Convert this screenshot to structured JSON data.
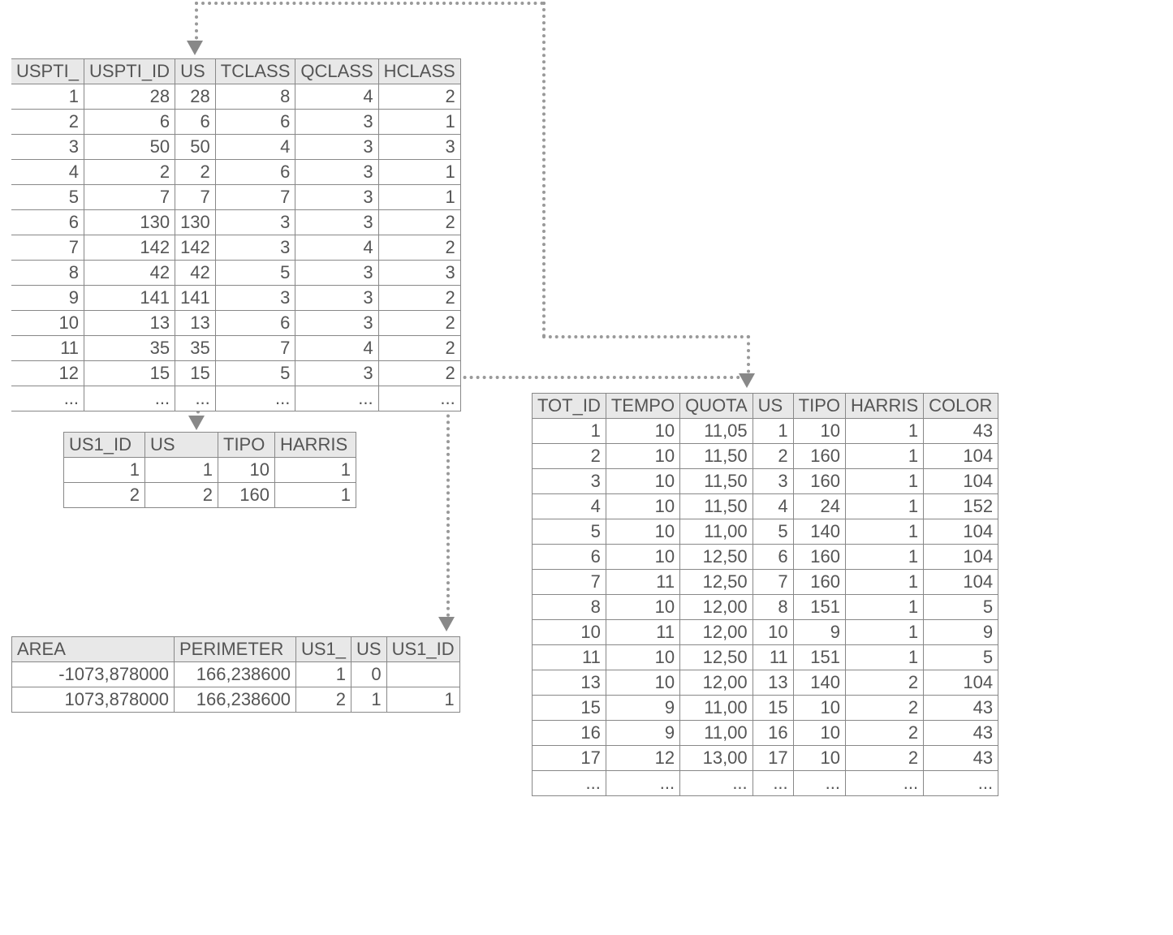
{
  "table_top": {
    "headers": [
      "USPTI_",
      "USPTI_ID",
      "US",
      "TCLASS",
      "QCLASS",
      "HCLASS"
    ],
    "rows": [
      [
        "1",
        "28",
        "28",
        "8",
        "4",
        "2"
      ],
      [
        "2",
        "6",
        "6",
        "6",
        "3",
        "1"
      ],
      [
        "3",
        "50",
        "50",
        "4",
        "3",
        "3"
      ],
      [
        "4",
        "2",
        "2",
        "6",
        "3",
        "1"
      ],
      [
        "5",
        "7",
        "7",
        "7",
        "3",
        "1"
      ],
      [
        "6",
        "130",
        "130",
        "3",
        "3",
        "2"
      ],
      [
        "7",
        "142",
        "142",
        "3",
        "4",
        "2"
      ],
      [
        "8",
        "42",
        "42",
        "5",
        "3",
        "3"
      ],
      [
        "9",
        "141",
        "141",
        "3",
        "3",
        "2"
      ],
      [
        "10",
        "13",
        "13",
        "6",
        "3",
        "2"
      ],
      [
        "11",
        "35",
        "35",
        "7",
        "4",
        "2"
      ],
      [
        "12",
        "15",
        "15",
        "5",
        "3",
        "2"
      ],
      [
        "...",
        "...",
        "...",
        "...",
        "...",
        "..."
      ]
    ]
  },
  "table_mid": {
    "headers": [
      "US1_ID",
      "US",
      "TIPO",
      "HARRIS"
    ],
    "rows": [
      [
        "1",
        "1",
        "10",
        "1"
      ],
      [
        "2",
        "2",
        "160",
        "1"
      ]
    ]
  },
  "table_bottom": {
    "headers": [
      "AREA",
      "PERIMETER",
      "US1_",
      "US",
      "US1_ID"
    ],
    "rows": [
      [
        "-1073,878000",
        "166,238600",
        "1",
        "0",
        ""
      ],
      [
        "1073,878000",
        "166,238600",
        "2",
        "1",
        "1"
      ]
    ]
  },
  "table_right": {
    "headers": [
      "TOT_ID",
      "TEMPO",
      "QUOTA",
      "US",
      "TIPO",
      "HARRIS",
      "COLOR"
    ],
    "rows": [
      [
        "1",
        "10",
        "11,05",
        "1",
        "10",
        "1",
        "43"
      ],
      [
        "2",
        "10",
        "11,50",
        "2",
        "160",
        "1",
        "104"
      ],
      [
        "3",
        "10",
        "11,50",
        "3",
        "160",
        "1",
        "104"
      ],
      [
        "4",
        "10",
        "11,50",
        "4",
        "24",
        "1",
        "152"
      ],
      [
        "5",
        "10",
        "11,00",
        "5",
        "140",
        "1",
        "104"
      ],
      [
        "6",
        "10",
        "12,50",
        "6",
        "160",
        "1",
        "104"
      ],
      [
        "7",
        "11",
        "12,50",
        "7",
        "160",
        "1",
        "104"
      ],
      [
        "8",
        "10",
        "12,00",
        "8",
        "151",
        "1",
        "5"
      ],
      [
        "10",
        "11",
        "12,00",
        "10",
        "9",
        "1",
        "9"
      ],
      [
        "11",
        "10",
        "12,50",
        "11",
        "151",
        "1",
        "5"
      ],
      [
        "13",
        "10",
        "12,00",
        "13",
        "140",
        "2",
        "104"
      ],
      [
        "15",
        "9",
        "11,00",
        "15",
        "10",
        "2",
        "43"
      ],
      [
        "16",
        "9",
        "11,00",
        "16",
        "10",
        "2",
        "43"
      ],
      [
        "17",
        "12",
        "13,00",
        "17",
        "10",
        "2",
        "43"
      ],
      [
        "...",
        "...",
        "...",
        "...",
        "...",
        "...",
        "..."
      ]
    ]
  }
}
